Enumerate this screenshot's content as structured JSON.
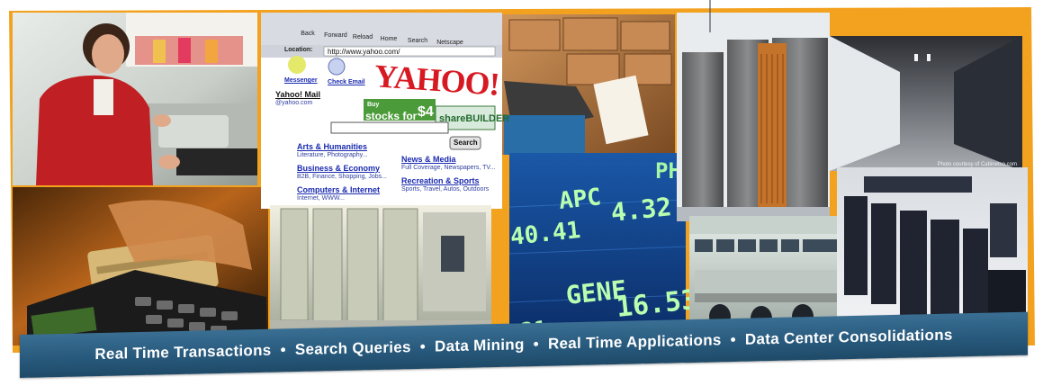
{
  "caption": {
    "items": [
      "Real Time Transactions",
      "Search Queries",
      "Data Mining",
      "Real Time Applications",
      "Data Center Consolidations"
    ],
    "separator": "•"
  },
  "browser": {
    "toolbar": [
      "Back",
      "Forward",
      "Reload",
      "Home",
      "Search",
      "Netscape"
    ],
    "location_label": "Location:",
    "url": "http://www.yahoo.com/",
    "logo": "YAHOO!",
    "left_links": [
      "Messenger",
      "Check Email"
    ],
    "mail_title": "Yahoo! Mail",
    "mail_sub": "@yahoo.com",
    "ad_buy": "Buy",
    "ad_stocks": "stocks for",
    "ad_price": "$4",
    "ad_brand": "shareBUILDER",
    "search_button": "Search",
    "categories_left": [
      {
        "title": "Arts & Humanities",
        "sub": "Literature, Photography..."
      },
      {
        "title": "Business & Economy",
        "sub": "B2B, Finance, Shopping, Jobs..."
      },
      {
        "title": "Computers & Internet",
        "sub": "Internet, WWW..."
      }
    ],
    "categories_right": [
      {
        "title": "News & Media",
        "sub": "Full Coverage, Newspapers, TV..."
      },
      {
        "title": "Recreation & Sports",
        "sub": "Sports, Travel, Autos, Outdoors"
      }
    ]
  },
  "ticker": {
    "rows": [
      {
        "symbol": "APC",
        "value": "4.32"
      },
      {
        "symbol": "40.41",
        "value": ""
      },
      {
        "symbol": "GENE",
        "value": "16.53"
      },
      {
        "symbol": "21",
        "value": ""
      }
    ],
    "top_right": "PH"
  },
  "photo_credit": "Photo courtesy of Cabinetco.com",
  "colors": {
    "accent_border": "#f3a21f",
    "caption_bg": "#285a7d",
    "caption_text": "#ffffff"
  }
}
